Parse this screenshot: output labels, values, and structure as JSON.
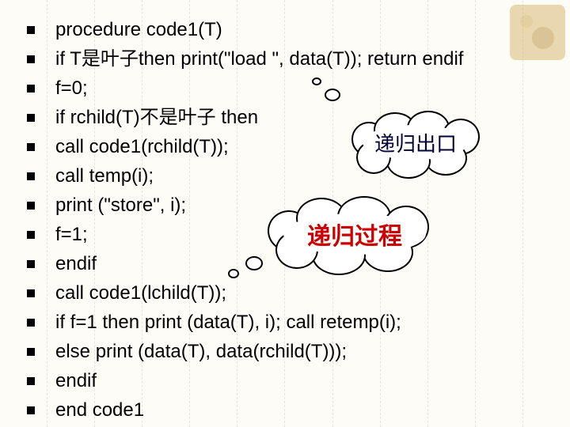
{
  "lines": [
    "procedure code1(T)",
    "if T是叶子then print(\"load \", data(T)); return endif",
    "f=0;",
    "if rchild(T)不是叶子 then",
    " call code1(rchild(T));",
    " call  temp(i);",
    " print (\"store\", i);",
    "  f=1;",
    "endif",
    "call code1(lchild(T));",
    "if f=1 then print (data(T), i);      call retemp(i);",
    "          else  print (data(T), data(rchild(T)));",
    "endif",
    "end code1"
  ],
  "callouts": {
    "exit": "递归出口",
    "process": "递归过程"
  }
}
